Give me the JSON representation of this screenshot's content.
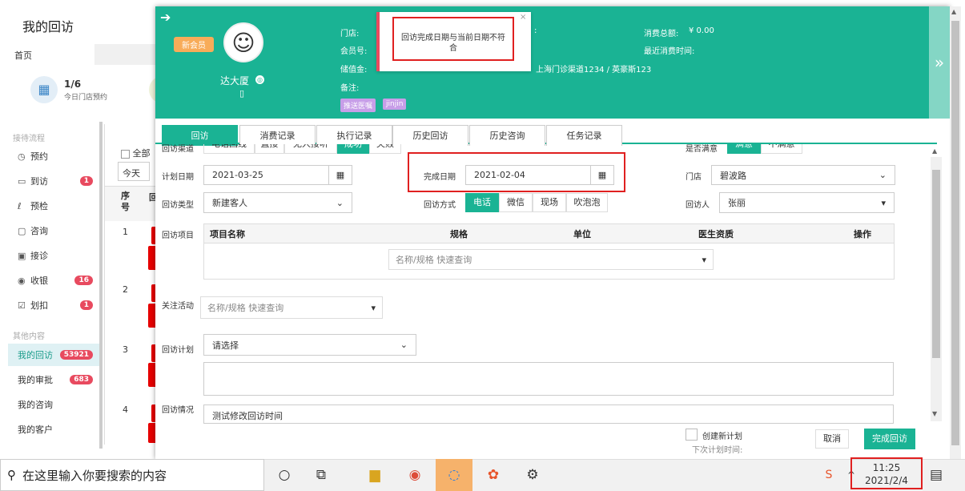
{
  "app": {
    "title": "我的回访"
  },
  "home_tab": "首页",
  "stat": {
    "value": "1/6",
    "label": "今日门店预约"
  },
  "sidebar": {
    "section1": "接待流程",
    "items": [
      {
        "icon": "clock-icon",
        "glyph": "◷",
        "label": "预约",
        "badge": ""
      },
      {
        "icon": "card-icon",
        "glyph": "▭",
        "label": "到访",
        "badge": "1"
      },
      {
        "icon": "stethoscope-icon",
        "glyph": "ℓ",
        "label": "预检",
        "badge": ""
      },
      {
        "icon": "chat-icon",
        "glyph": "▢",
        "label": "咨询",
        "badge": ""
      },
      {
        "icon": "clipboard-icon",
        "glyph": "▣",
        "label": "接诊",
        "badge": ""
      },
      {
        "icon": "coin-icon",
        "glyph": "◉",
        "label": "收银",
        "badge": "16"
      },
      {
        "icon": "check-icon",
        "glyph": "☑",
        "label": "划扣",
        "badge": "1"
      }
    ],
    "section2": "其他内容",
    "items2": [
      {
        "label": "我的回访",
        "badge": "53921",
        "active": true
      },
      {
        "label": "我的审批",
        "badge": "683"
      },
      {
        "label": "我的咨询",
        "badge": ""
      },
      {
        "label": "我的客户",
        "badge": ""
      }
    ]
  },
  "behind": {
    "all": "全部",
    "today": "今天",
    "col_seq": "序号",
    "col2": "回",
    "rows": [
      "1",
      "2",
      "3",
      "4"
    ]
  },
  "customer": {
    "badge": "新会员",
    "name": "达大厦",
    "labels": {
      "store": "门店:",
      "member_no": "会员号:",
      "deposit": "储值金:",
      "note": "备注:",
      "total": "消费总额:",
      "recent": "最近消费时间:"
    },
    "total_value": "¥ 0.00",
    "address": "上海门诊渠道1234 / 英豪斯123",
    "tags": [
      "推送医嘱",
      "jinjin"
    ]
  },
  "toast": {
    "message": "回访完成日期与当前日期不符合",
    "close": "×"
  },
  "tabs": [
    "回访",
    "消费记录",
    "执行记录",
    "历史回访",
    "历史咨询",
    "任务记录"
  ],
  "form": {
    "row0": {
      "label": "回访渠道",
      "options": [
        "电话回线",
        "直接",
        "无人接听",
        "成功",
        "失败"
      ],
      "satisfied_label": "是否满意",
      "satisfied": [
        "满意",
        "不满意"
      ]
    },
    "plan_date": {
      "label": "计划日期",
      "value": "2021-03-25"
    },
    "done_date": {
      "label": "完成日期",
      "value": "2021-02-04"
    },
    "store": {
      "label": "门店",
      "value": "碧波路"
    },
    "visit_type": {
      "label": "回访类型",
      "value": "新建客人"
    },
    "visit_method": {
      "label": "回访方式",
      "options": [
        "电话",
        "微信",
        "现场",
        "吹泡泡"
      ]
    },
    "visitor": {
      "label": "回访人",
      "value": "张丽"
    },
    "project": {
      "label": "回访项目",
      "headers": [
        "项目名称",
        "规格",
        "单位",
        "医生资质",
        "操作"
      ],
      "placeholder": "名称/规格 快速查询"
    },
    "activity": {
      "label": "关注活动",
      "placeholder": "名称/规格 快速查询"
    },
    "plan": {
      "label": "回访计划",
      "value": "请选择"
    },
    "situation": {
      "label": "回访情况",
      "value": "测试修改回访时间"
    }
  },
  "footer": {
    "new_plan": "创建新计划",
    "next_time": "下次计划时间:",
    "cancel": "取消",
    "finish": "完成回访"
  },
  "taskbar": {
    "search_placeholder": "在这里输入你要搜索的内容",
    "time": "11:25",
    "date": "2021/2/4"
  }
}
